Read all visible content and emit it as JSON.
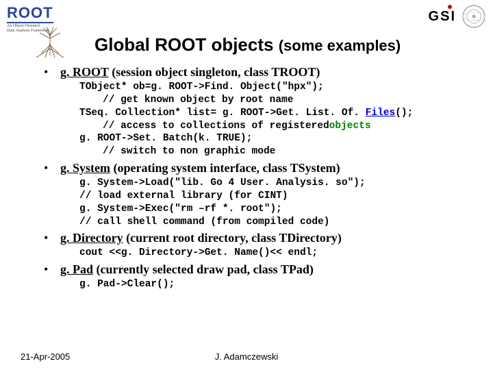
{
  "header": {
    "logo_text": "ROOT",
    "logo_sub1": "An Object-Oriented",
    "logo_sub2": "Data Analysis Framework",
    "gsi": "GSI"
  },
  "title_main": "Global ROOT objects ",
  "title_sub": "(some examples)",
  "items": [
    {
      "name": "g. ROOT",
      "desc": " (session object singleton, class TROOT)",
      "code": [
        {
          "t": "TObject* ob=g. ROOT->Find. Object(\"hpx\");"
        },
        {
          "t": "// get known object by root name",
          "cls": "indent"
        },
        {
          "t": "TSeq. Collection* list= g. ROOT->Get. List. Of. ",
          "tail": "Files",
          "tail_cls": "blue",
          "after": "();"
        },
        {
          "t": "// access to collections of registered ",
          "cls": "indent",
          "tail": "objects",
          "tail_cls": "green"
        },
        {
          "t": "g. ROOT->Set. Batch(k. TRUE);"
        },
        {
          "t": "// switch to non graphic mode",
          "cls": "indent"
        }
      ]
    },
    {
      "name": "g. System",
      "desc": " (operating system interface, class TSystem)",
      "code": [
        {
          "t": "g. System->Load(\"lib. Go 4 User. Analysis. so\");"
        },
        {
          "t": "// load external library (for CINT)"
        },
        {
          "t": "g. System->Exec(\"rm –rf *. root\");"
        },
        {
          "t": "// call shell command (from compiled code)"
        }
      ]
    },
    {
      "name": "g. Directory",
      "desc": " (current root directory, class TDirectory)",
      "code": [
        {
          "t": "cout <<g. Directory->Get. Name()<< endl;"
        }
      ]
    },
    {
      "name": "g. Pad",
      "desc": " (currently selected draw pad, class TPad)",
      "code": [
        {
          "t": "g. Pad->Clear();"
        }
      ]
    }
  ],
  "footer": {
    "date": "21-Apr-2005",
    "author": "J. Adamczewski"
  }
}
